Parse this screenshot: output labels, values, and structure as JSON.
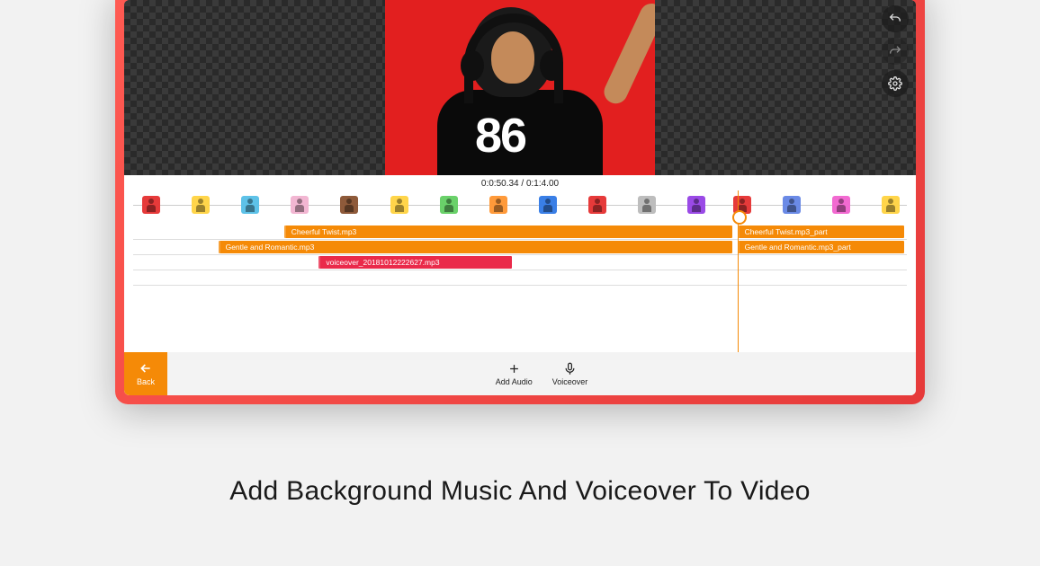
{
  "caption": "Add Background Music And Voiceover To Video",
  "preview": {
    "jersey_number": "86",
    "time_readout": "0:0:50.34 / 0:1:4.00"
  },
  "controls": {
    "undo": "undo-icon",
    "redo": "redo-icon",
    "settings": "gear-icon"
  },
  "timeline": {
    "playhead_pct": 77.5,
    "thumbs": [
      {
        "left_pct": 1.2,
        "bg": "#e63a3a"
      },
      {
        "left_pct": 7.6,
        "bg": "#ffd54a"
      },
      {
        "left_pct": 14.0,
        "bg": "#5ec2e8"
      },
      {
        "left_pct": 20.4,
        "bg": "#f2b6d2"
      },
      {
        "left_pct": 26.8,
        "bg": "#8e5a3a"
      },
      {
        "left_pct": 33.2,
        "bg": "#ffd54a"
      },
      {
        "left_pct": 39.6,
        "bg": "#6ad16a"
      },
      {
        "left_pct": 46.0,
        "bg": "#ff9a3a"
      },
      {
        "left_pct": 52.4,
        "bg": "#3a7fe6"
      },
      {
        "left_pct": 58.8,
        "bg": "#e63a3a"
      },
      {
        "left_pct": 65.2,
        "bg": "#bdbdbd"
      },
      {
        "left_pct": 71.6,
        "bg": "#9a4ae6"
      },
      {
        "left_pct": 77.5,
        "bg": "#e63a3a"
      },
      {
        "left_pct": 84.0,
        "bg": "#6a8ae6"
      },
      {
        "left_pct": 90.4,
        "bg": "#f26ad1"
      },
      {
        "left_pct": 96.8,
        "bg": "#ffd54a"
      }
    ],
    "tracks": [
      {
        "clips": [
          {
            "label": "Cheerful Twist.mp3",
            "left_pct": 19.5,
            "width_pct": 58.0,
            "color": "orange"
          },
          {
            "label": "Cheerful Twist.mp3_part",
            "left_pct": 78.1,
            "width_pct": 21.5,
            "color": "orange"
          }
        ]
      },
      {
        "clips": [
          {
            "label": "Gentle and Romantic.mp3",
            "left_pct": 11.0,
            "width_pct": 66.5,
            "color": "orange"
          },
          {
            "label": "Gentle and Romantic.mp3_part",
            "left_pct": 78.1,
            "width_pct": 21.5,
            "color": "orange"
          }
        ]
      },
      {
        "clips": [
          {
            "label": "voiceover_20181012222627.mp3",
            "left_pct": 24.0,
            "width_pct": 25.0,
            "color": "red"
          }
        ]
      },
      {
        "clips": []
      }
    ]
  },
  "bottombar": {
    "back_label": "Back",
    "add_audio_label": "Add Audio",
    "voiceover_label": "Voiceover"
  }
}
